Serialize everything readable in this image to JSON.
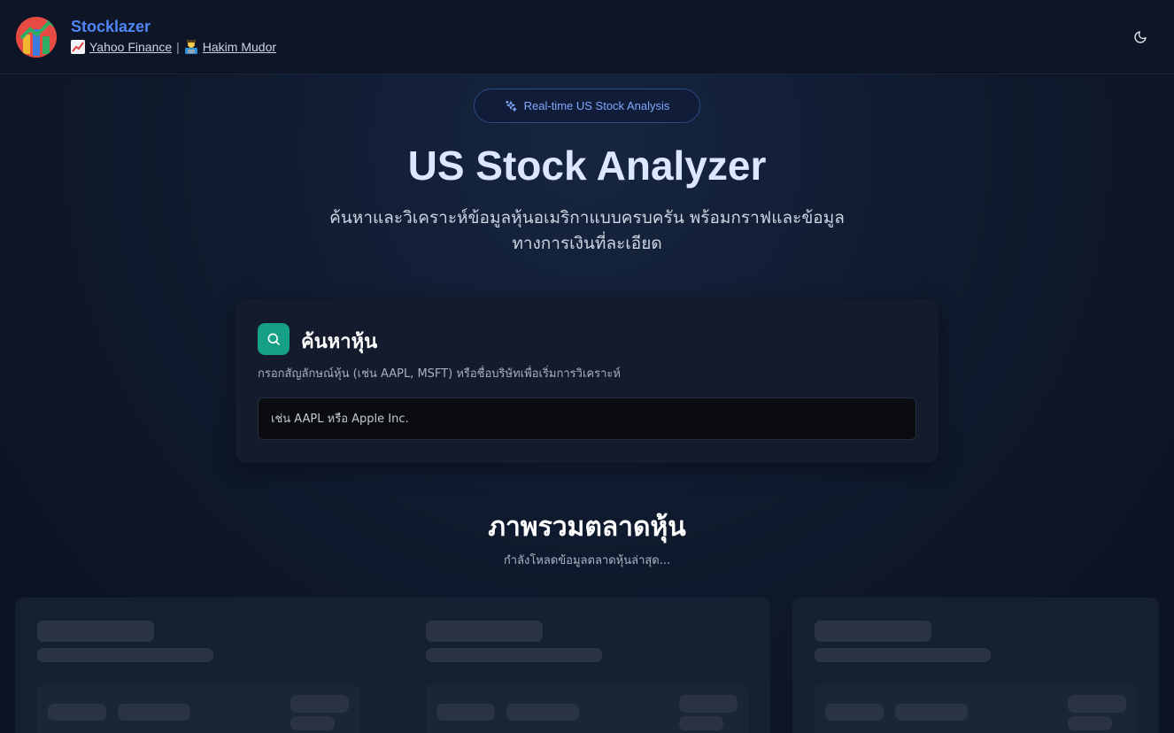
{
  "header": {
    "brand_name": "Stocklazer",
    "link_1_label": "Yahoo Finance",
    "separator": "|",
    "link_2_label": "Hakim Mudor",
    "theme_icon": "moon-icon"
  },
  "hero": {
    "badge_label": "Real-time US Stock Analysis",
    "badge_icon": "sparkles-icon",
    "title": "US Stock Analyzer",
    "subtitle_line1": "ค้นหาและวิเคราะห์ข้อมูลหุ้นอเมริกาแบบครบครัน พร้อมกราฟและข้อมูล",
    "subtitle_line2": "ทางการเงินที่ละเอียด"
  },
  "search": {
    "title": "ค้นหาหุ้น",
    "description": "กรอกสัญลักษณ์หุ้น (เช่น AAPL, MSFT) หรือชื่อบริษัทเพื่อเริ่มการวิเคราะห์",
    "placeholder": "เช่น AAPL หรือ Apple Inc.",
    "value": ""
  },
  "market": {
    "title": "ภาพรวมตลาดหุ้น",
    "loading_text": "กำลังโหลดข้อมูลตลาดหุ้นล่าสุด..."
  },
  "colors": {
    "accent_blue": "#4f86f7",
    "accent_green": "#16a085",
    "background": "#0b1120"
  }
}
